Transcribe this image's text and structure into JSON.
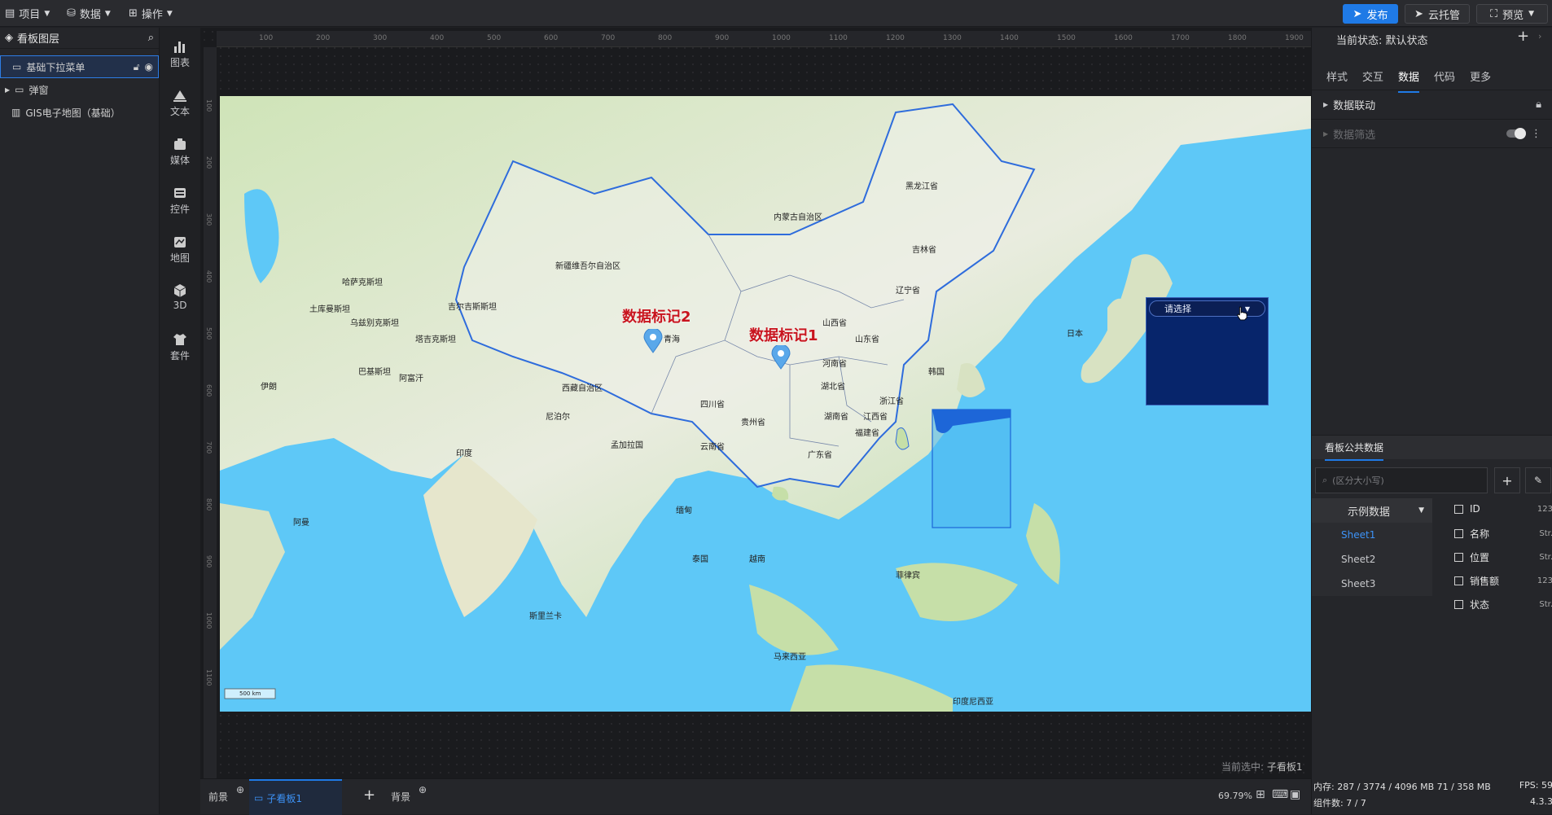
{
  "topbar": {
    "menus": [
      "项目",
      "数据",
      "操作"
    ],
    "publish_label": "发布",
    "cloud_label": "云托管",
    "preview_label": "预览"
  },
  "layers_panel": {
    "title": "看板图层",
    "items": [
      {
        "label": "基础下拉菜单",
        "selected": true
      },
      {
        "label": "弹窗",
        "selected": false
      },
      {
        "label": "GIS电子地图（基础）",
        "selected": false
      }
    ]
  },
  "component_bar": {
    "items": [
      "图表",
      "文本",
      "媒体",
      "控件",
      "地图",
      "3D",
      "套件"
    ]
  },
  "ruler": {
    "ticks": [
      "100",
      "200",
      "300",
      "400",
      "500",
      "600",
      "700",
      "800",
      "900",
      "1000",
      "1100",
      "1200",
      "1300",
      "1400",
      "1500",
      "1600",
      "1700",
      "1800",
      "1900"
    ],
    "vticks": [
      "100",
      "200",
      "300",
      "400",
      "500",
      "600",
      "700",
      "800",
      "900",
      "1000",
      "1100"
    ]
  },
  "map": {
    "marker1_label": "数据标记1",
    "marker2_label": "数据标记2",
    "scale_label": "500 km",
    "labels": [
      "新疆维吾尔自治区",
      "西藏自治区",
      "青海",
      "四川省",
      "内蒙古自治区",
      "黑龙江省",
      "吉林省",
      "辽宁省",
      "山西省",
      "河南省",
      "山东省",
      "湖北省",
      "湖南省",
      "江西省",
      "浙江省",
      "福建省",
      "广东省",
      "云南省",
      "贵州省",
      "日本",
      "哈萨克斯坦",
      "土库曼斯坦",
      "阿富汗",
      "伊朗",
      "巴基斯坦",
      "印度",
      "尼泊尔",
      "孟加拉国",
      "缅甸",
      "泰国",
      "越南",
      "菲律宾",
      "马来西亚",
      "斯里兰卡",
      "印度尼西亚",
      "阿曼",
      "乌兹别克斯坦",
      "吉尔吉斯斯坦",
      "塔吉克斯坦",
      "韩国"
    ]
  },
  "dropdown_widget": {
    "placeholder": "请选择"
  },
  "canvas_status": {
    "selected_prefix": "当前选中:",
    "selected_name": "子看板1"
  },
  "bottom_tabs": {
    "foreground": "前景",
    "subboard": "子看板1",
    "background": "背景",
    "zoom": "69.79%"
  },
  "right_panel": {
    "state_label": "当前状态: 默认状态",
    "tabs": [
      "样式",
      "交互",
      "数据",
      "代码",
      "更多"
    ],
    "active_tab": "数据",
    "section_linkage": "数据联动",
    "section_filter": "数据筛选",
    "public_data_title": "看板公共数据",
    "search_placeholder": "(区分大小写)",
    "dataset_select": "示例数据",
    "sheets": [
      "Sheet1",
      "Sheet2",
      "Sheet3"
    ],
    "active_sheet": "Sheet1",
    "fields": [
      {
        "name": "ID",
        "type": "123"
      },
      {
        "name": "名称",
        "type": "Str."
      },
      {
        "name": "位置",
        "type": "Str."
      },
      {
        "name": "销售额",
        "type": "123"
      },
      {
        "name": "状态",
        "type": "Str."
      }
    ]
  },
  "status_footer": {
    "memory": "内存: 287 / 3774 / 4096 MB  71 / 358 MB",
    "fps": "FPS: 59",
    "components": "组件数: 7 / 7",
    "version": "4.3.3"
  },
  "colors": {
    "accent": "#1f7ae6",
    "marker_text": "#c8141e",
    "dropdown_bg": "#07256b"
  }
}
